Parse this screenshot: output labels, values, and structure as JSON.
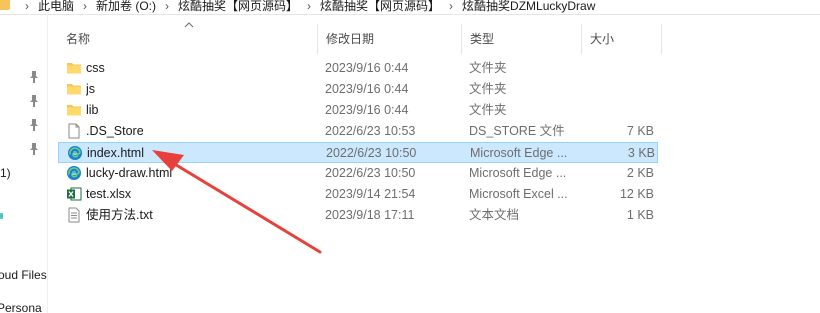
{
  "breadcrumb": {
    "items": [
      "此电脑",
      "新加卷 (O:)",
      "炫酷抽奖【网页源码】",
      "炫酷抽奖【网页源码】",
      "炫酷抽奖DZMLuckyDraw"
    ],
    "separator": "›"
  },
  "nav": {
    "partial_items": [
      "1)",
      "oud Files",
      "Persona"
    ]
  },
  "columns": {
    "name": "名称",
    "date": "修改日期",
    "type": "类型",
    "size": "大小"
  },
  "files": [
    {
      "name": "css",
      "date": "2023/9/16 0:44",
      "type": "文件夹",
      "size": "",
      "icon": "folder-icon"
    },
    {
      "name": "js",
      "date": "2023/9/16 0:44",
      "type": "文件夹",
      "size": "",
      "icon": "folder-icon"
    },
    {
      "name": "lib",
      "date": "2023/9/16 0:44",
      "type": "文件夹",
      "size": "",
      "icon": "folder-icon"
    },
    {
      "name": ".DS_Store",
      "date": "2022/6/23 10:53",
      "type": "DS_STORE 文件",
      "size": "7 KB",
      "icon": "blank-file-icon"
    },
    {
      "name": "index.html",
      "date": "2022/6/23 10:50",
      "type": "Microsoft Edge ...",
      "size": "3 KB",
      "icon": "edge-html-icon",
      "selected": true
    },
    {
      "name": "lucky-draw.html",
      "date": "2022/6/23 10:50",
      "type": "Microsoft Edge ...",
      "size": "2 KB",
      "icon": "edge-html-icon"
    },
    {
      "name": "test.xlsx",
      "date": "2023/9/14 21:54",
      "type": "Microsoft Excel ...",
      "size": "12 KB",
      "icon": "excel-file-icon"
    },
    {
      "name": "使用方法.txt",
      "date": "2023/9/18 17:11",
      "type": "文本文档",
      "size": "1 KB",
      "icon": "text-file-icon"
    }
  ],
  "colors": {
    "selection_bg": "#cce8ff",
    "selection_border": "#99d1ff",
    "folder": "#f4c55a",
    "annotation_arrow": "#e8413b",
    "excel": "#1d6f42",
    "edge": "#1b7fd6"
  }
}
